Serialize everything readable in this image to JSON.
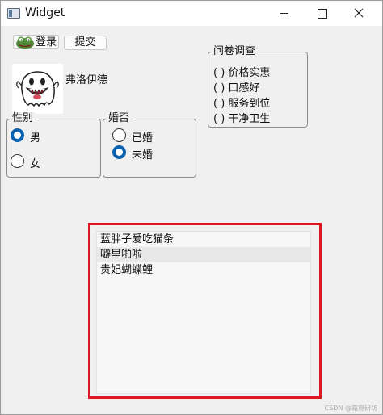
{
  "window": {
    "title": "Widget"
  },
  "toolbar": {
    "login_label": "登录",
    "submit_label": "提交"
  },
  "profile": {
    "name": "弗洛伊德"
  },
  "gender_group": {
    "title": "性别",
    "options": [
      "男",
      "女"
    ],
    "selected": "男"
  },
  "married_group": {
    "title": "婚否",
    "options": [
      "已婚",
      "未婚"
    ],
    "selected": "未婚"
  },
  "survey_group": {
    "title": "问卷调查",
    "items": [
      "( ) 价格实惠",
      "( ) 口感好",
      "( ) 服务到位",
      "( ) 干净卫生"
    ]
  },
  "list": {
    "items": [
      "蓝胖子爱吃猫条",
      "噼里啪啦",
      "贵妃蝴蝶鲤"
    ],
    "hover_index": 1
  },
  "watermark": "CSDN @霜霓研坊",
  "colors": {
    "accent": "#0a63b0",
    "highlight": "#e0161e"
  }
}
